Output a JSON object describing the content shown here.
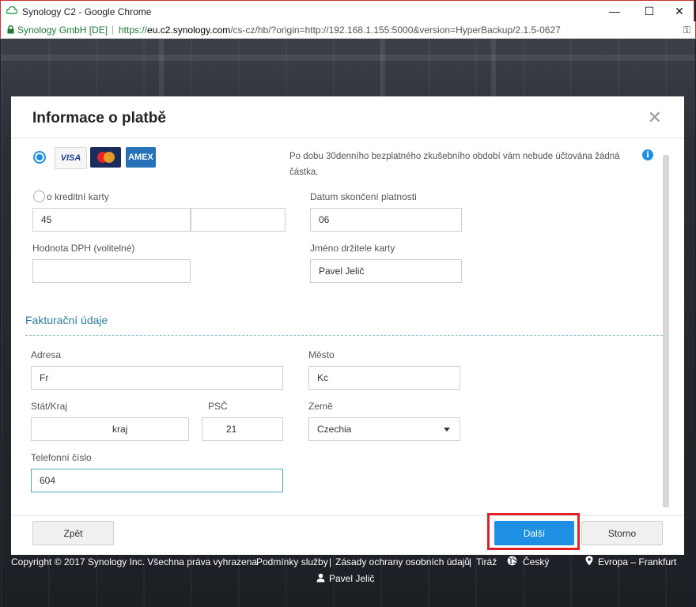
{
  "window": {
    "title": "Synology C2 - Google Chrome",
    "minimize": "—",
    "maximize": "☐",
    "close": "✕"
  },
  "address_bar": {
    "organization": "Synology GmbH [DE]",
    "separator": "|",
    "url_prefix": "https://",
    "url_domain": "eu.c2.synology.com",
    "url_rest": "/cs-cz/hb/?origin=http://192.168.1.155:5000&version=HyperBackup/2.1.5-0627"
  },
  "modal": {
    "title": "Informace o platbě",
    "close": "✕",
    "cards": [
      "VISA",
      "Mastercard",
      "AMEX"
    ],
    "info_text": "Po dobu 30denního bezplatného zkušebního období vám nebude účtována žádná částka.",
    "info_icon": "i",
    "card_number": {
      "label": "Číslo kreditní karty",
      "label_visible": "o kreditní karty",
      "value1": "45",
      "value2": ""
    },
    "expiry": {
      "label": "Datum skončení platnosti",
      "value": "06"
    },
    "vat": {
      "label": "Hodnota DPH (volitelné)",
      "value": ""
    },
    "holder": {
      "label": "Jméno držitele karty",
      "value": "Pavel Jelič"
    },
    "billing": {
      "title": "Fakturační údaje",
      "address": {
        "label": "Adresa",
        "value": "Fr"
      },
      "city": {
        "label": "Město",
        "value": "Kc"
      },
      "state": {
        "label": "Stát/Kraj",
        "value": "kraj"
      },
      "zip": {
        "label": "PSČ",
        "value": "21"
      },
      "country": {
        "label": "Země",
        "value": "Czechia"
      },
      "phone": {
        "label": "Telefonní číslo",
        "value": "604"
      }
    },
    "buttons": {
      "back": "Zpět",
      "next": "Další",
      "cancel": "Storno"
    }
  },
  "footer": {
    "copyright": "Copyright © 2017 Synology Inc. Všechna práva vyhrazena",
    "terms": "Podmínky služby",
    "sep1": "|",
    "privacy": "Zásady ochrany osobních údajů",
    "sep2": "|",
    "imprint": "Tiráž",
    "language": "Český",
    "region": "Evropa – Frankfurt",
    "user": "Pavel Jelič"
  },
  "colors": {
    "accent": "#1e8fe3",
    "highlight": "#e22028",
    "section": "#2c7da0"
  }
}
